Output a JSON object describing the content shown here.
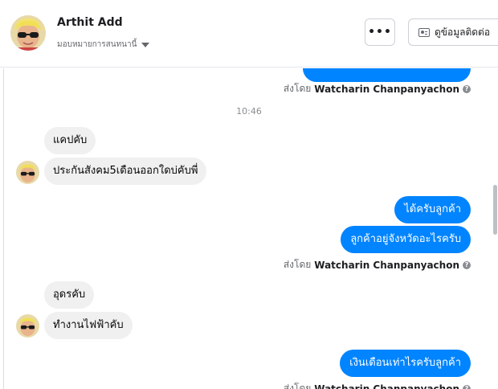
{
  "header": {
    "contact_name": "Arthit Add",
    "assign_label": "มอบหมายการสนทนานี้",
    "more_label": "•••",
    "view_contact_label": "ดูข้อมูลติดต่อ"
  },
  "chat": {
    "sent_by_prefix": "ส่งโดย",
    "agent_name": "Watcharin Chanpanyachon",
    "timestamp": "10:46",
    "messages": [
      {
        "dir": "in",
        "text": "แคปคับ"
      },
      {
        "dir": "in",
        "text": "ประกันสังคม5เดือนออกใดบ่คับพี่"
      },
      {
        "dir": "out",
        "text": "ได้ครับลูกค้า"
      },
      {
        "dir": "out",
        "text": "ลูกค้าอยู่จังหวัดอะไรครับ"
      },
      {
        "dir": "in",
        "text": "อุดรคับ"
      },
      {
        "dir": "in",
        "text": "ทำงานไฟฟ้าคับ"
      },
      {
        "dir": "out",
        "text": "เงินเดือนเท่าไรครับลูกค้า"
      }
    ]
  },
  "colors": {
    "outgoing_bubble": "#0084ff",
    "incoming_bubble": "#f0f0f0",
    "meta_text": "#65676b"
  }
}
